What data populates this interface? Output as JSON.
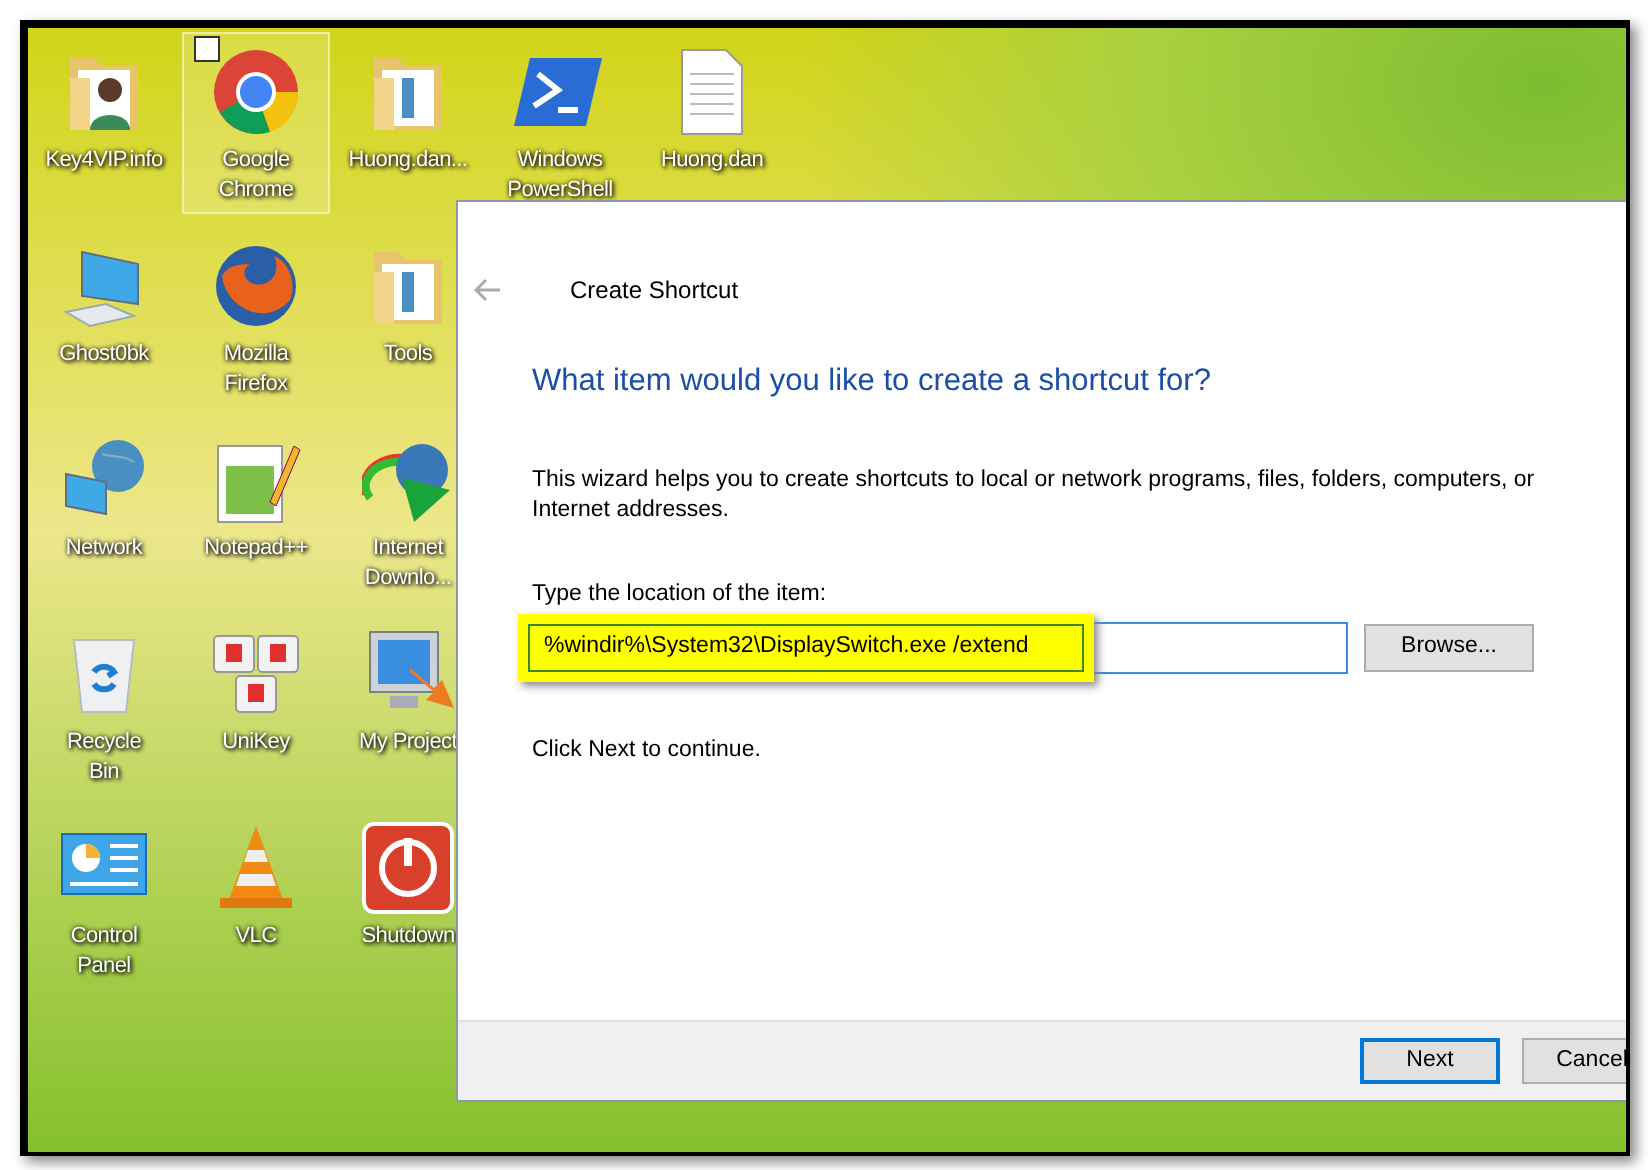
{
  "desktop_columns": [
    {
      "icons": [
        {
          "label": "Key4VIP.info",
          "selected": false
        },
        {
          "label": "Ghost0bk",
          "selected": false
        },
        {
          "label": "Network",
          "selected": false
        },
        {
          "label": "Recycle Bin",
          "selected": false
        },
        {
          "label": "Control Panel",
          "selected": false
        }
      ]
    },
    {
      "icons": [
        {
          "label": "Google Chrome",
          "selected": true
        },
        {
          "label": "Mozilla Firefox",
          "selected": false
        },
        {
          "label": "Notepad++",
          "selected": false
        },
        {
          "label": "UniKey",
          "selected": false
        },
        {
          "label": "VLC",
          "selected": false
        }
      ]
    },
    {
      "icons": [
        {
          "label": "Huong.dan...",
          "selected": false
        },
        {
          "label": "Tools",
          "selected": false
        },
        {
          "label": "Internet Downlo...",
          "selected": false
        },
        {
          "label": "My Project",
          "selected": false
        },
        {
          "label": "Shutdown",
          "selected": false
        }
      ]
    },
    {
      "icons": [
        {
          "label": "Windows PowerShell",
          "selected": false
        }
      ]
    },
    {
      "icons": [
        {
          "label": "Huong.dan",
          "selected": false
        }
      ]
    }
  ],
  "dialog": {
    "title": "Create Shortcut",
    "heading": "What item would you like to create a shortcut for?",
    "description": "This wizard helps you to create shortcuts to local or network programs, files, folders, computers, or Internet addresses.",
    "location_label": "Type the location of the item:",
    "location_value": "%windir%\\System32\\DisplaySwitch.exe /extend",
    "browse": "Browse...",
    "hint": "Click Next to continue.",
    "next": "Next",
    "cancel": "Cancel"
  }
}
